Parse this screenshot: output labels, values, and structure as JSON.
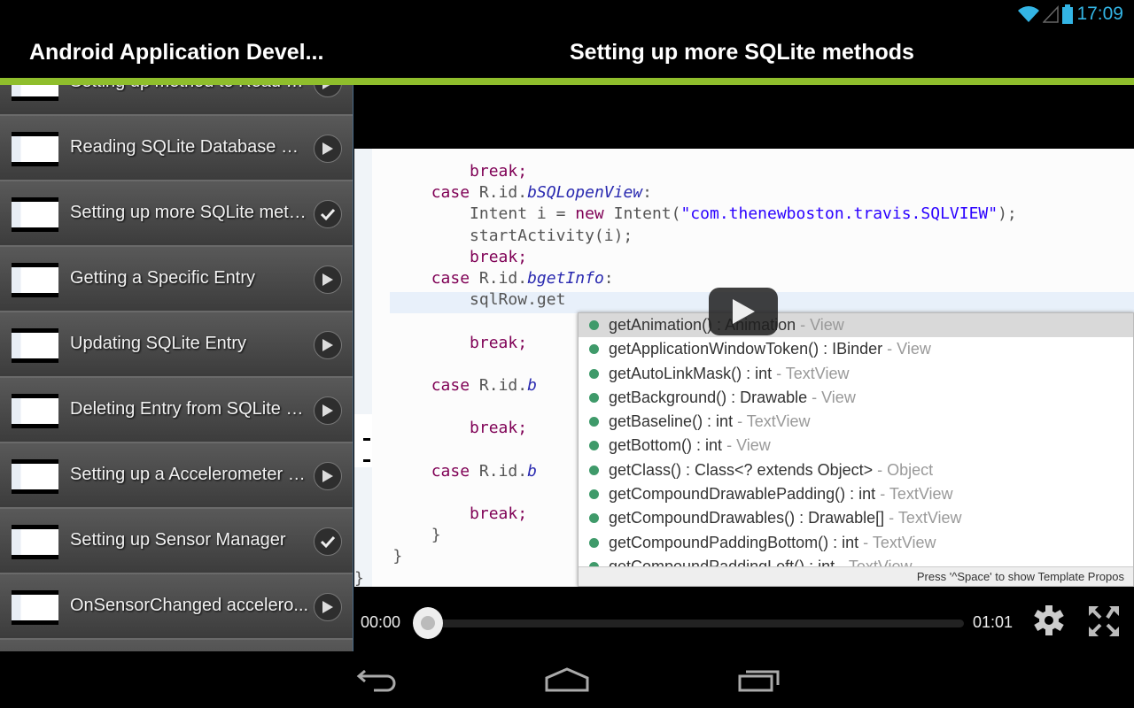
{
  "status_bar": {
    "time": "17:09",
    "icons": [
      "wifi-icon",
      "signal-icon",
      "battery-icon"
    ],
    "accent_color": "#33b5e5"
  },
  "action_bar": {
    "app_title": "Android Application Devel...",
    "video_title": "Setting up more SQLite methods",
    "accent_color": "#8fbe2c"
  },
  "playlist": [
    {
      "title": "Setting up method to Read S...",
      "status": "play"
    },
    {
      "title": "Reading SQLite Database wit...",
      "status": "play"
    },
    {
      "title": "Setting up more SQLite meth...",
      "status": "watched"
    },
    {
      "title": "Getting a Specific Entry",
      "status": "play"
    },
    {
      "title": "Updating SQLite Entry",
      "status": "play"
    },
    {
      "title": "Deleting Entry from SQLite D...",
      "status": "play"
    },
    {
      "title": "Setting up a Accelerometer c...",
      "status": "play"
    },
    {
      "title": "Setting up Sensor Manager",
      "status": "watched"
    },
    {
      "title": "OnSensorChanged accelero...",
      "status": "play"
    }
  ],
  "video_frame": {
    "code_lines": [
      "            break;",
      "        case R.id.bSQLopenView:",
      "            Intent i = new Intent(\"com.thenewboston.travis.SQLVIEW\");",
      "            startActivity(i);",
      "            break;",
      "        case R.id.bgetInfo:",
      "            sqlRow.get",
      "",
      "            break;",
      "",
      "        case R.id.b",
      "",
      "            break;",
      "",
      "        case R.id.b",
      "",
      "            break;",
      "        }",
      "    }",
      "}"
    ],
    "autocomplete": [
      {
        "sig": "getAnimation() : Animation",
        "src": "View"
      },
      {
        "sig": "getApplicationWindowToken() : IBinder",
        "src": "View"
      },
      {
        "sig": "getAutoLinkMask() : int",
        "src": "TextView"
      },
      {
        "sig": "getBackground() : Drawable",
        "src": "View"
      },
      {
        "sig": "getBaseline() : int",
        "src": "TextView"
      },
      {
        "sig": "getBottom() : int",
        "src": "View"
      },
      {
        "sig": "getClass() : Class<? extends Object>",
        "src": "Object"
      },
      {
        "sig": "getCompoundDrawablePadding() : int",
        "src": "TextView"
      },
      {
        "sig": "getCompoundDrawables() : Drawable[]",
        "src": "TextView"
      },
      {
        "sig": "getCompoundPaddingBottom() : int",
        "src": "TextView"
      },
      {
        "sig": "getCompoundPaddingLeft() : int",
        "src": "TextView"
      }
    ],
    "autocomplete_footer": "Press '^Space' to show Template Propos"
  },
  "player": {
    "current_time": "00:00",
    "duration": "01:01",
    "progress": 0
  },
  "nav_bar": {
    "icons": [
      "back-icon",
      "home-icon",
      "recent-apps-icon"
    ]
  }
}
